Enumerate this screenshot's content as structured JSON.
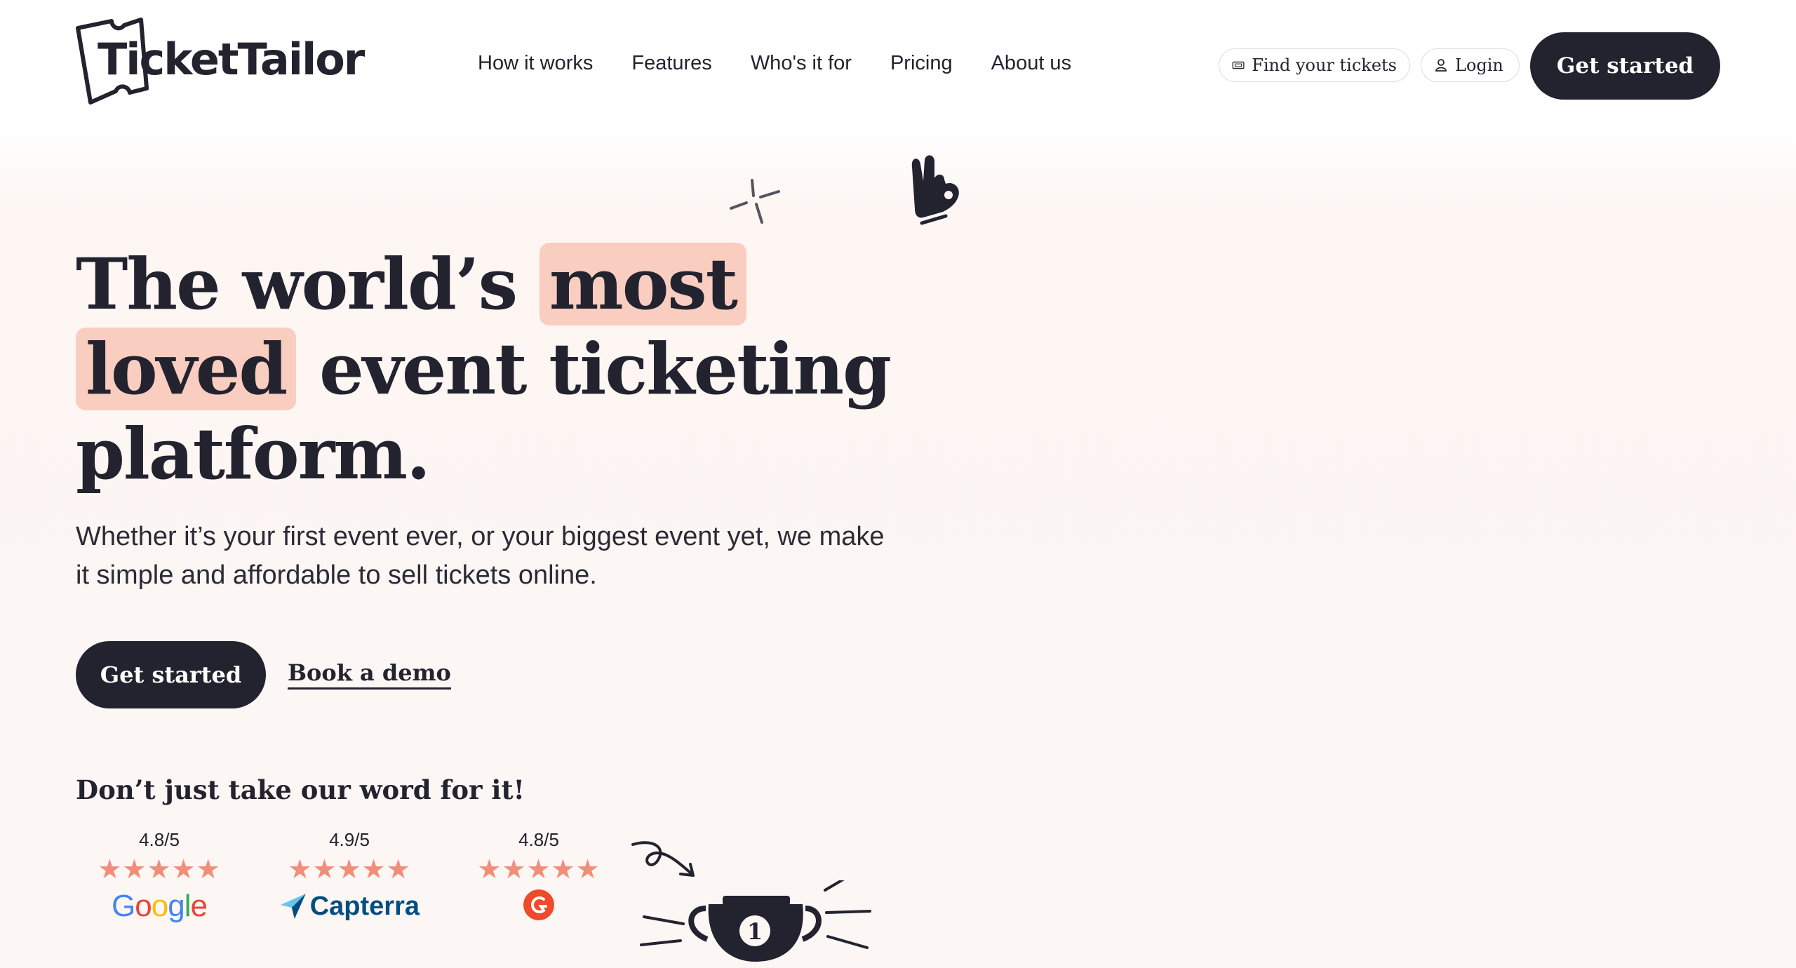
{
  "header": {
    "logo_text": "TicketTailor",
    "nav": [
      "How it works",
      "Features",
      "Who's it for",
      "Pricing",
      "About us"
    ],
    "find_tickets_label": "Find your tickets",
    "login_label": "Login",
    "get_started_label": "Get started"
  },
  "hero": {
    "headline": {
      "part1": "The world’s",
      "highlight1": "most",
      "highlight2": "loved",
      "part2": "event ticketing",
      "part3": "platform."
    },
    "subtext": "Whether it’s your first event ever, or your biggest event yet, we make it simple and affordable to sell tickets online.",
    "primary_cta": "Get started",
    "secondary_cta": "Book a demo"
  },
  "reviews": {
    "title": "Don’t just take our word for it!",
    "items": [
      {
        "score": "4.8/5",
        "stars": "★★★★★",
        "source": "Google",
        "rating": 4.8
      },
      {
        "score": "4.9/5",
        "stars": "★★★★★",
        "source": "Capterra",
        "rating": 4.9
      },
      {
        "score": "4.8/5",
        "stars": "★★★★★",
        "source": "G2",
        "rating": 4.8
      }
    ]
  },
  "decor": {
    "trophy_number": "1",
    "icons": [
      "ticket-logo-icon",
      "ticket-icon",
      "user-icon",
      "sparkle-icon",
      "ok-hand-icon",
      "curly-arrow-icon",
      "trophy-icon"
    ]
  },
  "colors": {
    "dark": "#23232f",
    "highlight": "#f9cdbf",
    "star": "#f08e7a",
    "background": "#fcf6f4"
  }
}
